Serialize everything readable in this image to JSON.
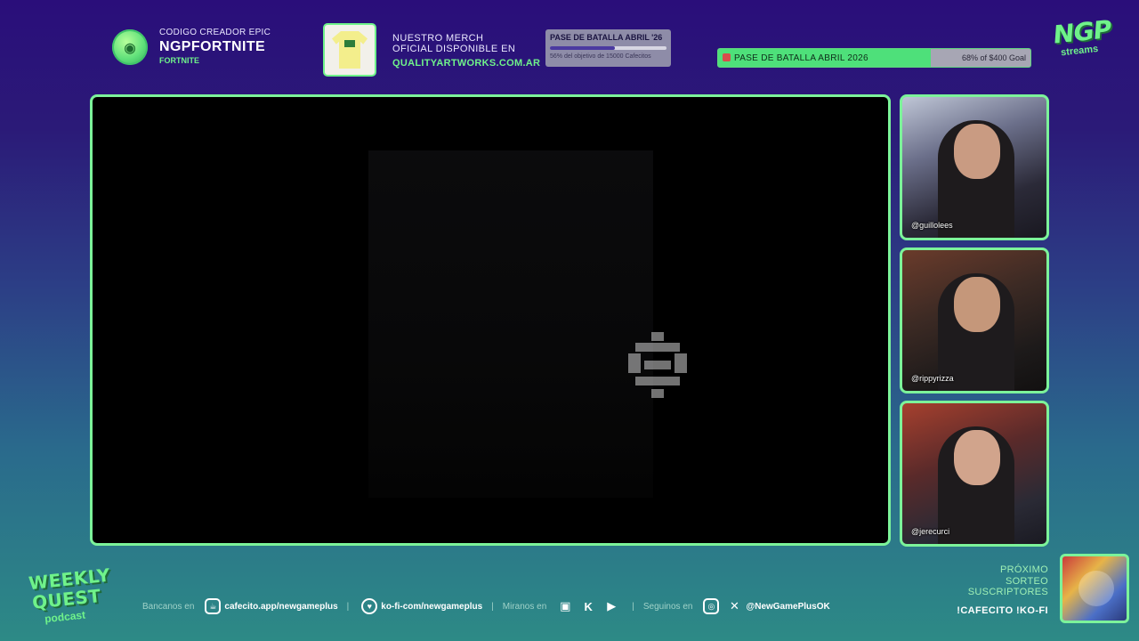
{
  "creator": {
    "line1": "CODIGO CREADOR EPIC",
    "line2": "NGPFORTNITE",
    "line3": "FORTNITE"
  },
  "merch": {
    "line1": "NUESTRO MERCH",
    "line2": "OFICIAL DISPONIBLE EN",
    "url": "QUALITYARTWORKS.COM.AR"
  },
  "goal_small": {
    "title": "PASE DE BATALLA ABRIL '26",
    "progress": 0.56,
    "text": "56% del objetivo de 15000 Cafecitos"
  },
  "goal_big": {
    "title": "PASE DE BATALLA ABRIL 2026",
    "progress": 0.68,
    "amount": "68% of $400 Goal"
  },
  "logo_top": {
    "big": "NGP",
    "small": "streams"
  },
  "cams": [
    {
      "handle": "@guillolees"
    },
    {
      "handle": "@rippyrizza"
    },
    {
      "handle": "@jerecurci"
    }
  ],
  "logo_bottom": {
    "w1": "WEEKLY",
    "w2": "QUEST",
    "w3": "podcast"
  },
  "footer": {
    "bancanos": "Bancanos en",
    "cafecito": "cafecito.app/newgameplus",
    "kofi": "ko-fi-com/newgameplus",
    "miranos": "Miranos en",
    "seguinos": "Seguinos en",
    "handle": "@NewGamePlusOK"
  },
  "sorteo": {
    "l1": "PRÓXIMO",
    "l2": "SORTEO",
    "l3": "SUSCRIPTORES",
    "cmd": "!CAFECITO !KO-FI"
  },
  "colors": {
    "accent": "#7cf39a",
    "bg_top": "#2a0e7a",
    "bg_bottom": "#2d8a86"
  },
  "icons": [
    "coin-icon",
    "cafecito-icon",
    "kofi-icon",
    "twitch-icon",
    "kick-icon",
    "youtube-icon",
    "instagram-icon",
    "x-icon"
  ]
}
